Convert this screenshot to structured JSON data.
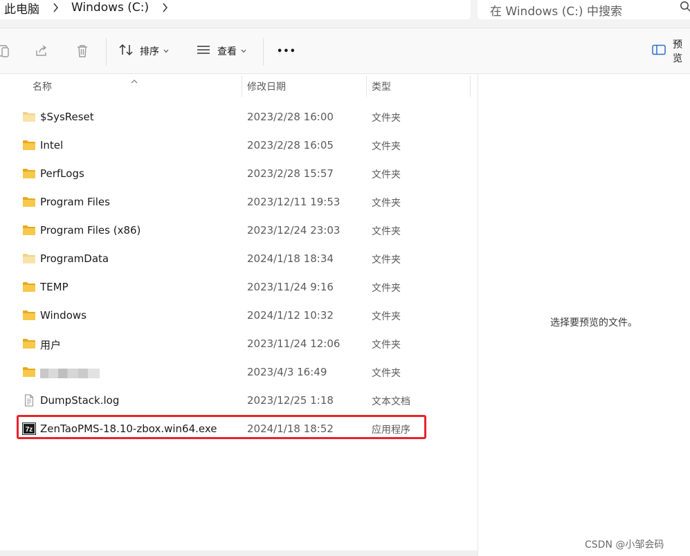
{
  "address": {
    "breadcrumbs": [
      "此电脑",
      "Windows (C:)"
    ]
  },
  "search": {
    "placeholder": "在 Windows (C:) 中搜索"
  },
  "toolbar": {
    "sort_label": "排序",
    "view_label": "查看",
    "more_label": "•••",
    "details_label": "预览"
  },
  "columns": {
    "name": "名称",
    "date": "修改日期",
    "type": "类型"
  },
  "files": [
    {
      "name": "$SysReset",
      "date": "2023/2/28 16:00",
      "type": "文件夹",
      "icon": "folder-faded-icon"
    },
    {
      "name": "Intel",
      "date": "2023/2/28 16:05",
      "type": "文件夹",
      "icon": "folder-icon"
    },
    {
      "name": "PerfLogs",
      "date": "2023/2/28 15:57",
      "type": "文件夹",
      "icon": "folder-icon"
    },
    {
      "name": "Program Files",
      "date": "2023/12/11 19:53",
      "type": "文件夹",
      "icon": "folder-icon"
    },
    {
      "name": "Program Files (x86)",
      "date": "2023/12/24 23:03",
      "type": "文件夹",
      "icon": "folder-icon"
    },
    {
      "name": "ProgramData",
      "date": "2024/1/18 18:34",
      "type": "文件夹",
      "icon": "folder-faded-icon"
    },
    {
      "name": "TEMP",
      "date": "2023/11/24 9:16",
      "type": "文件夹",
      "icon": "folder-icon"
    },
    {
      "name": "Windows",
      "date": "2024/1/12 10:32",
      "type": "文件夹",
      "icon": "folder-icon"
    },
    {
      "name": "用户",
      "date": "2023/11/24 12:06",
      "type": "文件夹",
      "icon": "folder-icon"
    },
    {
      "name": "",
      "date": "2023/4/3 16:49",
      "type": "文件夹",
      "icon": "folder-icon"
    },
    {
      "name": "DumpStack.log",
      "date": "2023/12/25 1:18",
      "type": "文本文档",
      "icon": "text-document-icon"
    },
    {
      "name": "ZenTaoPMS-18.10-zbox.win64.exe",
      "date": "2024/1/18 18:52",
      "type": "应用程序",
      "icon": "7zip-archive-icon"
    }
  ],
  "preview": {
    "message": "选择要预览的文件。"
  },
  "watermark": "CSDN @小邹会码",
  "colors": {
    "highlight": "#e8222a",
    "folder": "#f7c849"
  }
}
